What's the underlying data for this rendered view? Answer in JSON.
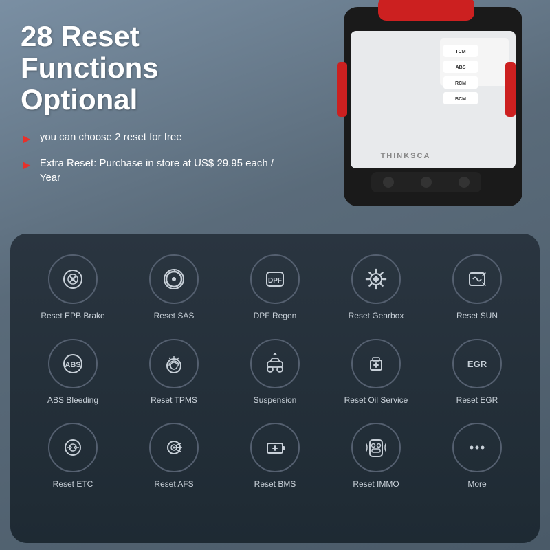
{
  "page": {
    "background_color": "#6b7a8d"
  },
  "header": {
    "headline": "28 Reset\nFunctions Optional",
    "bullets": [
      "you can choose 2 reset for free",
      "Extra Reset: Purchase in store at US$ 29.95 each / Year"
    ]
  },
  "functions": [
    {
      "id": "epb-brake",
      "label": "Reset EPB Brake",
      "icon": "epb"
    },
    {
      "id": "sas",
      "label": "Reset SAS",
      "icon": "sas"
    },
    {
      "id": "dpf",
      "label": "DPF Regen",
      "icon": "dpf"
    },
    {
      "id": "gearbox",
      "label": "Reset Gearbox",
      "icon": "gearbox"
    },
    {
      "id": "sun",
      "label": "Reset SUN",
      "icon": "sun"
    },
    {
      "id": "abs",
      "label": "ABS Bleeding",
      "icon": "abs"
    },
    {
      "id": "tpms",
      "label": "Reset TPMS",
      "icon": "tpms"
    },
    {
      "id": "suspension",
      "label": "Suspension",
      "icon": "suspension"
    },
    {
      "id": "oil",
      "label": "Reset Oil Service",
      "icon": "oil"
    },
    {
      "id": "egr",
      "label": "Reset EGR",
      "icon": "egr"
    },
    {
      "id": "etc",
      "label": "Reset ETC",
      "icon": "etc"
    },
    {
      "id": "afs",
      "label": "Reset AFS",
      "icon": "afs"
    },
    {
      "id": "bms",
      "label": "Reset BMS",
      "icon": "bms"
    },
    {
      "id": "immo",
      "label": "Reset IMMO",
      "icon": "immo"
    },
    {
      "id": "more",
      "label": "More",
      "icon": "more"
    }
  ]
}
